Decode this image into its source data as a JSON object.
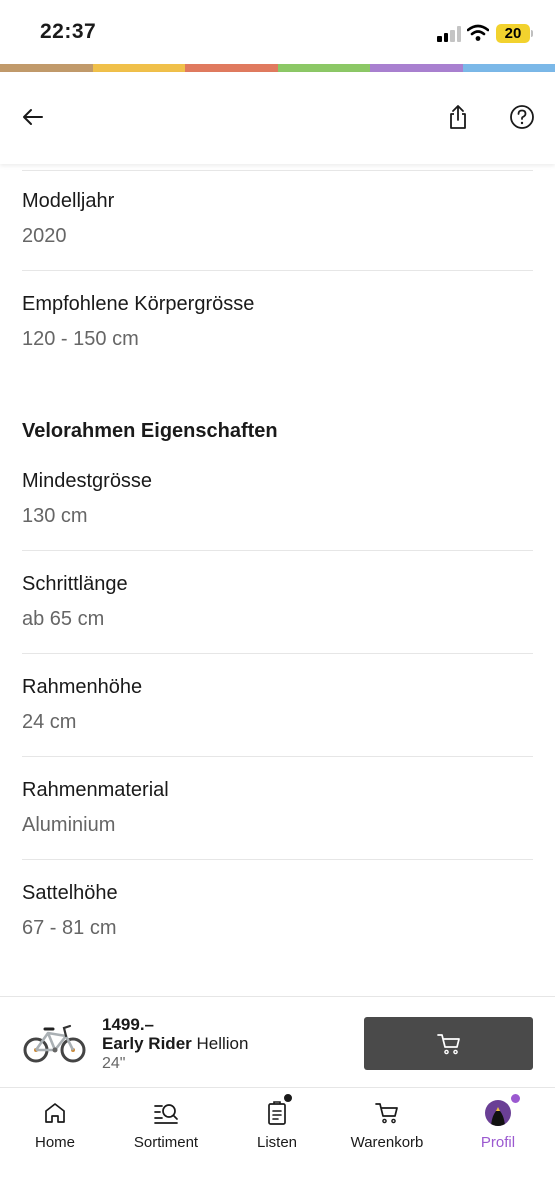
{
  "status_bar": {
    "time": "22:37",
    "battery": "20"
  },
  "brand_colors": [
    "#c19a6b",
    "#f0c04a",
    "#e07a5f",
    "#8cc866",
    "#a980d0",
    "#7bb8e8"
  ],
  "header": {
    "back_icon": "arrow-left-icon",
    "share_icon": "share-icon",
    "help_icon": "help-circle-icon"
  },
  "specs_general": [
    {
      "label": "Modelljahr",
      "value": "2020"
    },
    {
      "label": "Empfohlene Körpergrösse",
      "value": "120 - 150 cm"
    }
  ],
  "section_frame": {
    "title": "Velorahmen Eigenschaften",
    "items": [
      {
        "label": "Mindestgrösse",
        "value": "130 cm"
      },
      {
        "label": "Schrittlänge",
        "value": "ab 65 cm"
      },
      {
        "label": "Rahmenhöhe",
        "value": "24 cm"
      },
      {
        "label": "Rahmenmaterial",
        "value": "Aluminium"
      },
      {
        "label": "Sattelhöhe",
        "value": "67 - 81 cm"
      }
    ]
  },
  "product": {
    "price": "1499.–",
    "brand": "Early Rider",
    "model": "Hellion",
    "variant": "24\"",
    "cart_icon": "cart-icon"
  },
  "tabs": [
    {
      "label": "Home",
      "icon": "home-icon"
    },
    {
      "label": "Sortiment",
      "icon": "catalog-search-icon"
    },
    {
      "label": "Listen",
      "icon": "list-icon"
    },
    {
      "label": "Warenkorb",
      "icon": "cart-icon"
    },
    {
      "label": "Profil",
      "icon": "avatar-icon",
      "active": true
    }
  ],
  "colors": {
    "accent": "#9b59d0",
    "cart_button": "#4a4a4a"
  }
}
